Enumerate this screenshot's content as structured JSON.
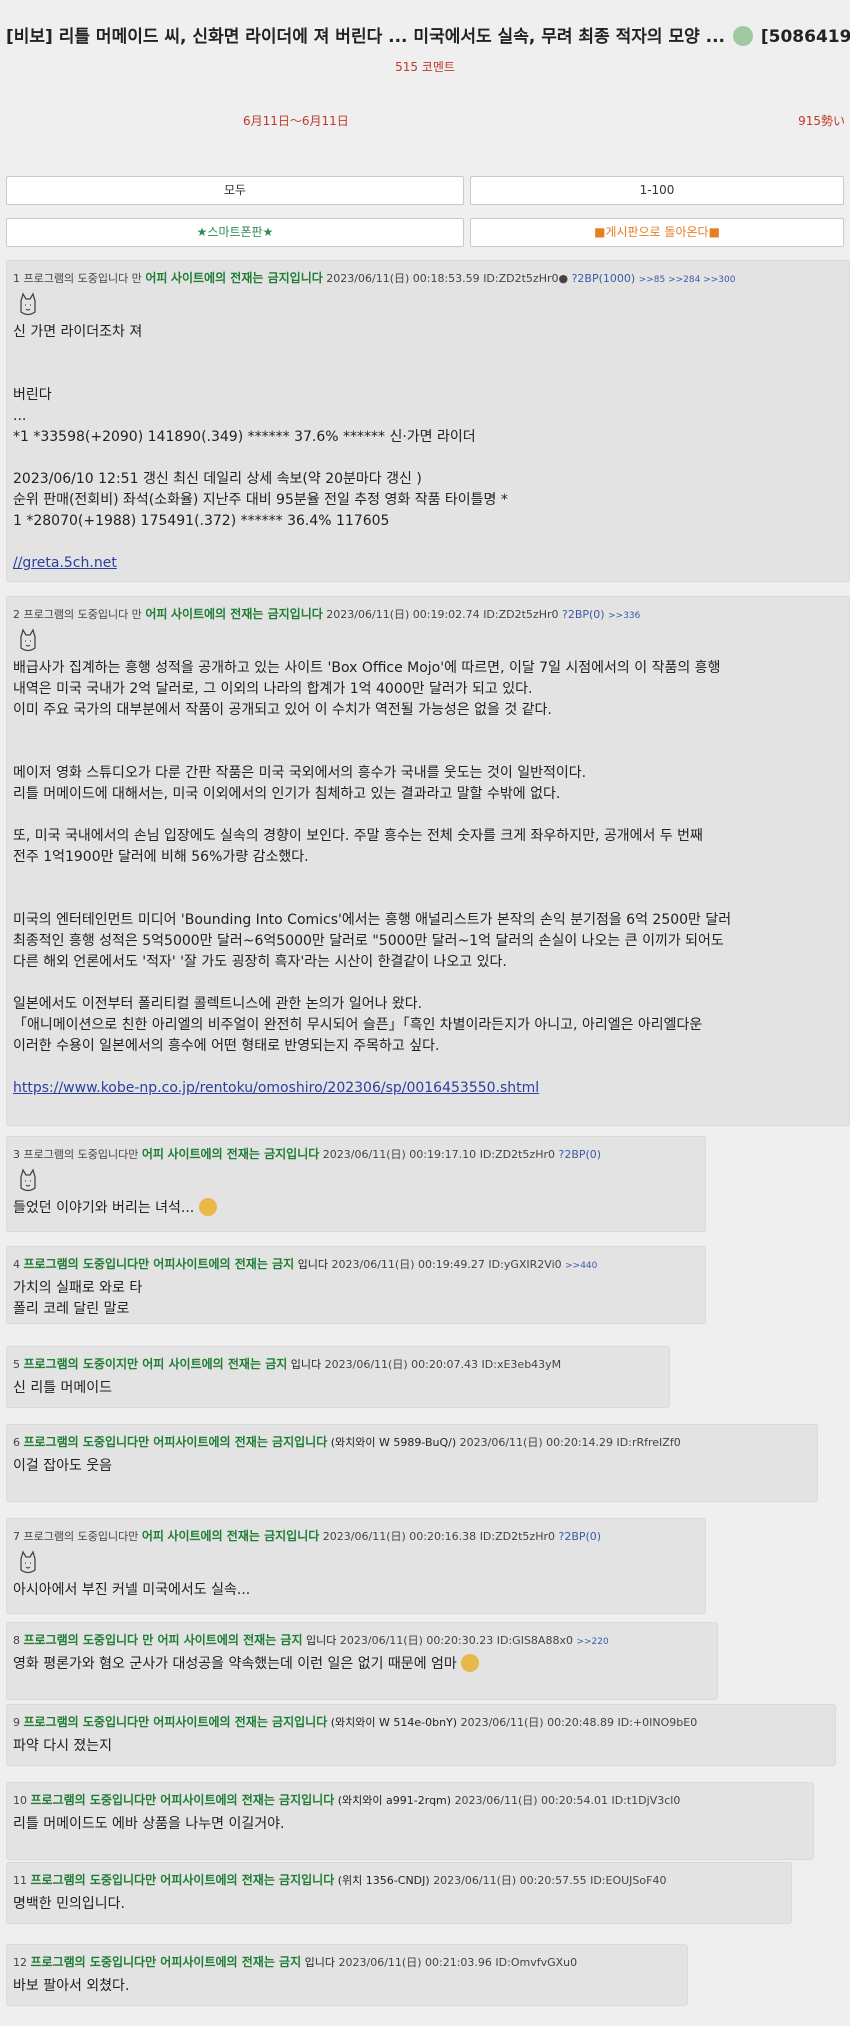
{
  "thread": {
    "title": "[비보] 리틀 머메이드 씨, 신화면 라이더에 져 버린다 ... 미국에서도 실속, 무려 최종 적자의 모양 ...",
    "thread_id": "[5086419",
    "comment_count": "515 코멘트",
    "date_range": "6月11日〜6月11日",
    "power": "915勢い"
  },
  "nav": {
    "all_label": "모두",
    "range_label": "1-100",
    "smart_label": "★스마트폰판★",
    "back_label": "■게시판으로 돌아온다■"
  },
  "posts": [
    {
      "name_prefix": "1 프로그램의 도중입니다 만",
      "name_mid": "어피",
      "name_bold": "사이트에의 전재는 금지입니다",
      "date": "2023/06/11(日) 00:18:53.59",
      "id": "ID:ZD2t5zHr0●",
      "bp": "?2BP(1000)",
      "refs": ">>85 >>284 >>300",
      "lines": [
        "신 가면 라이더조차 져",
        "",
        "",
        "버린다",
        "...",
        "*1 *33598(+2090) 141890(.349) ****** 37.6% ****** 신·가면 라이더",
        "",
        "2023/06/10 12:51 갱신 최신 데일리 상세 속보(약 20분마다 갱신 )",
        "순위 판매(전회비) 좌석(소화율) 지난주 대비 95분율 전일 추정 영화 작품 타이틀명 *",
        "1 *28070(+1988) 175491(.372) ****** 36.4% 117605",
        "",
        "//greta.5ch.net"
      ]
    },
    {
      "name_prefix": "2 프로그램의 도중입니다 만",
      "name_mid": "어피",
      "name_bold": "사이트에의 전재는 금지입니다",
      "date": "2023/06/11(日) 00:19:02.74",
      "id": "ID:ZD2t5zHr0",
      "bp": "?2BP(0)",
      "refs": ">>336",
      "lines": [
        "배급사가 집계하는 흥행 성적을 공개하고 있는 사이트 'Box Office Mojo'에 따르면, 이달 7일 시점에서의 이 작품의 흥행",
        "내역은 미국 국내가 2억 달러로, 그 이외의 나라의 합계가 1억 4000만 달러가 되고 있다.",
        "이미 주요 국가의 대부분에서 작품이 공개되고 있어 이 수치가 역전될 가능성은 없을 것 같다.",
        "",
        "",
        "메이저 영화 스튜디오가 다룬 간판 작품은 미국 국외에서의 흥수가 국내를 웃도는 것이 일반적이다.",
        "리틀 머메이드에 대해서는, 미국 이외에서의 인기가 침체하고 있는 결과라고 말할 수밖에 없다.",
        "",
        "또, 미국 국내에서의 손님 입장에도 실속의 경향이 보인다. 주말 흥수는 전체 숫자를 크게 좌우하지만, 공개에서 두 번째",
        "전주 1억1900만 달러에 비해 56%가량 감소했다.",
        "",
        "",
        "미국의 엔터테인먼트 미디어 'Bounding Into Comics'에서는 흥행 애널리스트가 본작의 손익 분기점을 6억 2500만 달러",
        "최종적인 흥행 성적은 5억5000만 달러~6억5000만 달러로 \"5000만 달러~1억 달러의 손실이 나오는 큰 이끼가 되어도",
        "다른 해외 언론에서도 '적자' '잘 가도 굉장히 흑자'라는 시산이 한결같이 나오고 있다.",
        "",
        "일본에서도 이전부터 폴리티컬 콜렉트니스에 관한 논의가 일어나 왔다.",
        "「애니메이션으로 친한 아리엘의 비주얼이 완전히 무시되어 슬픈」「흑인 차별이라든지가 아니고, 아리엘은 아리엘다운",
        "이러한 수용이 일본에서의 흥수에 어떤 형태로 반영되는지 주목하고 싶다.",
        "",
        "https://www.kobe-np.co.jp/rentoku/omoshiro/202306/sp/0016453550.shtml"
      ]
    },
    {
      "name_prefix": "3 프로그램의 도중입니다만",
      "name_mid": "어피",
      "name_bold": "사이트에의 전재는 금지입니다",
      "date": "2023/06/11(日) 00:19:17.10",
      "id": "ID:ZD2t5zHr0",
      "bp": "?2BP(0)",
      "refs": "",
      "lines": [
        "들었던 이야기와 버리는 녀석..."
      ]
    },
    {
      "name_prefix": "4",
      "name_mid": "",
      "name_bold": "프로그램의 도중입니다만 어피사이트에의 전재는 금지",
      "name_suffix": "입니다",
      "date": "2023/06/11(日) 00:19:49.27",
      "id": "ID:yGXIR2Vi0",
      "bp": "",
      "refs": ">>440",
      "lines": [
        "가치의 실패로 와로 타",
        "폴리 코레 달린 말로"
      ]
    },
    {
      "name_prefix": "5",
      "name_mid": "",
      "name_bold": "프로그램의 도중이지만 어피 사이트에의 전재는 금지",
      "name_suffix": "입니다",
      "date": "2023/06/11(日) 00:20:07.43",
      "id": "ID:xE3eb43yM",
      "bp": "",
      "refs": "",
      "lines": [
        "신 리틀 머메이드"
      ]
    },
    {
      "name_prefix": "6",
      "name_mid": "",
      "name_bold": "프로그램의 도중입니다만 어피사이트에의 전재는 금지입니다",
      "name_suffix": "(와치와이 W 5989-BuQ/)",
      "date": "2023/06/11(日) 00:20:14.29",
      "id": "ID:rRfreIZf0",
      "bp": "",
      "refs": "",
      "lines": [
        "이걸 잡아도 웃음"
      ]
    },
    {
      "name_prefix": "7 프로그램의 도중입니다만",
      "name_mid": "어피",
      "name_bold": "사이트에의 전재는 금지입니다",
      "date": "2023/06/11(日) 00:20:16.38",
      "id": "ID:ZD2t5zHr0",
      "bp": "?2BP(0)",
      "refs": "",
      "lines": [
        "아시아에서 부진 커넬 미국에서도 실속..."
      ]
    },
    {
      "name_prefix": "8",
      "name_mid": "",
      "name_bold": "프로그램의 도중입니다 만 어피 사이트에의 전재는 금지",
      "name_suffix": "입니다",
      "date": "2023/06/11(日) 00:20:30.23",
      "id": "ID:GIS8A88x0",
      "bp": "",
      "refs": ">>220",
      "lines": [
        "영화 평론가와 혐오 군사가 대성공을 약속했는데 이런 일은 없기 때문에 엄마"
      ]
    },
    {
      "name_prefix": "9",
      "name_mid": "",
      "name_bold": "프로그램의 도중입니다만 어피사이트에의 전재는 금지입니다",
      "name_suffix": "(와치와이 W 514e-0bnY)",
      "date": "2023/06/11(日) 00:20:48.89",
      "id": "ID:+0INO9bE0",
      "bp": "",
      "refs": "",
      "lines": [
        "파약 다시 졌는지"
      ]
    },
    {
      "name_prefix": "10",
      "name_mid": "",
      "name_bold": "프로그램의 도중입니다만 어피사이트에의 전재는 금지입니다",
      "name_suffix": "(와치와이 a991-2rqm)",
      "date": "2023/06/11(日) 00:20:54.01",
      "id": "ID:t1DjV3cl0",
      "bp": "",
      "refs": "",
      "lines": [
        "리틀 머메이드도 에바 상품을 나누면 이길거야."
      ]
    },
    {
      "name_prefix": "11",
      "name_mid": "",
      "name_bold": "프로그램의 도중입니다만 어피사이트에의 전재는 금지입니다",
      "name_suffix": "(위치 1356-CNDJ)",
      "date": "2023/06/11(日) 00:20:57.55",
      "id": "ID:EOUJSoF40",
      "bp": "",
      "refs": "",
      "lines": [
        "명백한 민의입니다."
      ]
    },
    {
      "name_prefix": "12",
      "name_mid": "",
      "name_bold": "프로그램의 도중입니다만 어피사이트에의 전재는 금지",
      "name_suffix": "입니다",
      "date": "2023/06/11(日) 00:21:03.96",
      "id": "ID:OmvfvGXu0",
      "bp": "",
      "refs": "",
      "lines": [
        "바보 팔아서 외쳤다."
      ]
    }
  ],
  "colors": {
    "name_green": "#1e7e34",
    "accent_red": "#c0392b",
    "link_blue": "#2a3fa0"
  }
}
